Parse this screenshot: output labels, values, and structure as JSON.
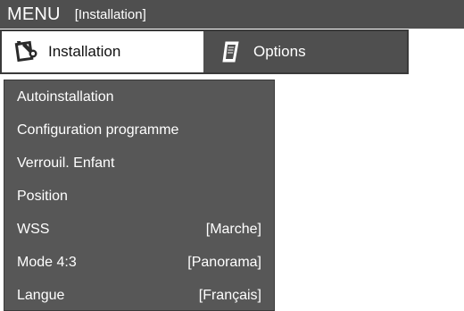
{
  "header": {
    "menu_title": "MENU",
    "breadcrumb": "[Installation]"
  },
  "tabs": [
    {
      "label": "Installation",
      "icon": "wrench-icon",
      "active": true
    },
    {
      "label": "Options",
      "icon": "document-icon",
      "active": false
    }
  ],
  "submenu": {
    "items": [
      {
        "label": "Autoinstallation",
        "value": ""
      },
      {
        "label": "Configuration programme",
        "value": ""
      },
      {
        "label": "Verrouil. Enfant",
        "value": ""
      },
      {
        "label": "Position",
        "value": ""
      },
      {
        "label": "WSS",
        "value": "[Marche]"
      },
      {
        "label": "Mode 4:3",
        "value": "[Panorama]"
      },
      {
        "label": "Langue",
        "value": "[Français]"
      }
    ]
  },
  "colors": {
    "bar": "#4f4f4f",
    "panel": "#575757",
    "text_light": "#ffffff",
    "text_dark": "#111111"
  }
}
